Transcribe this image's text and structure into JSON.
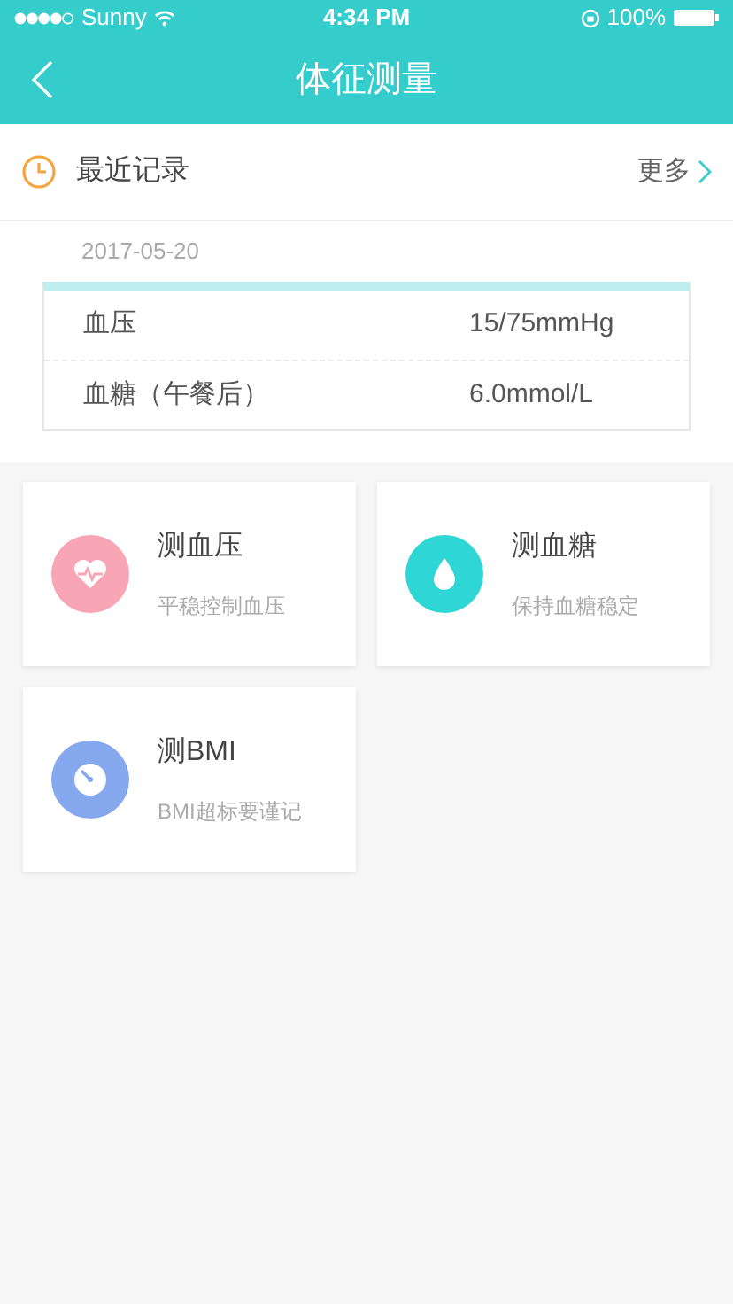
{
  "status_bar": {
    "carrier": "Sunny",
    "time": "4:34 PM",
    "battery": "100%"
  },
  "nav": {
    "title": "体征测量"
  },
  "recent": {
    "title": "最近记录",
    "more": "更多",
    "date": "2017-05-20",
    "rows": [
      {
        "label": "血压",
        "value": "15/75mmHg"
      },
      {
        "label": "血糖（午餐后）",
        "value": "6.0mmol/L"
      }
    ]
  },
  "cards": [
    {
      "kind": "heart",
      "color": "#f8a5b5",
      "title": "测血压",
      "subtitle": "平稳控制血压"
    },
    {
      "kind": "drop",
      "color": "#2fd6d6",
      "title": "测血糖",
      "subtitle": "保持血糖稳定"
    },
    {
      "kind": "gauge",
      "color": "#86a8ee",
      "title": "测BMI",
      "subtitle": "BMI超标要谨记"
    }
  ]
}
